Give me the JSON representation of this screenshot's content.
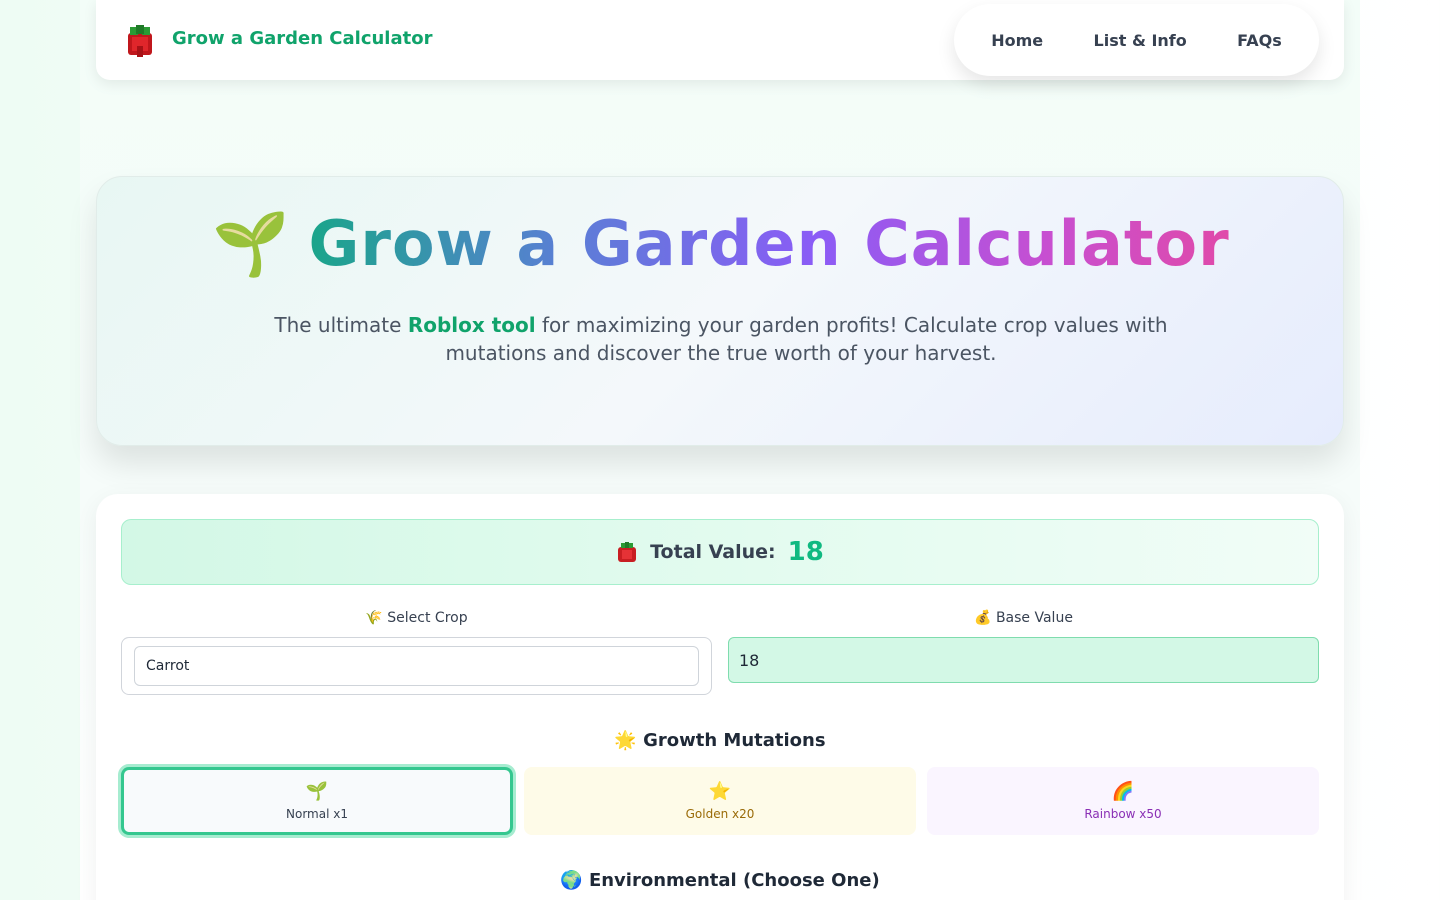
{
  "header": {
    "brand": "Grow a Garden Calculator",
    "logo_icon": "strawberry-block-icon",
    "nav": [
      {
        "label": "Home"
      },
      {
        "label": "List & Info"
      },
      {
        "label": "FAQs"
      }
    ]
  },
  "hero": {
    "emoji": "🌱",
    "title": "Grow a Garden Calculator",
    "subtitle_before": "The ultimate ",
    "subtitle_highlight": "Roblox tool",
    "subtitle_after": " for maximizing your garden profits! Calculate crop values with mutations and discover the true worth of your harvest."
  },
  "calculator": {
    "total_label": "Total Value:",
    "total_value": "18",
    "crop_label": "🌾 Select Crop",
    "crop_value": "Carrot",
    "base_label": "💰 Base Value",
    "base_value": "18",
    "growth_title": "🌟 Growth Mutations",
    "mutations": [
      {
        "icon": "🌱",
        "label": "Normal x1"
      },
      {
        "icon": "⭐",
        "label": "Golden x20"
      },
      {
        "icon": "🌈",
        "label": "Rainbow x50"
      }
    ],
    "env_title": "🌍 Environmental (Choose One)"
  },
  "colors": {
    "brand_green": "#10a36b",
    "value_green": "#10b981",
    "golden_text": "#9a6b08",
    "rainbow_text": "#8a2fb5"
  }
}
